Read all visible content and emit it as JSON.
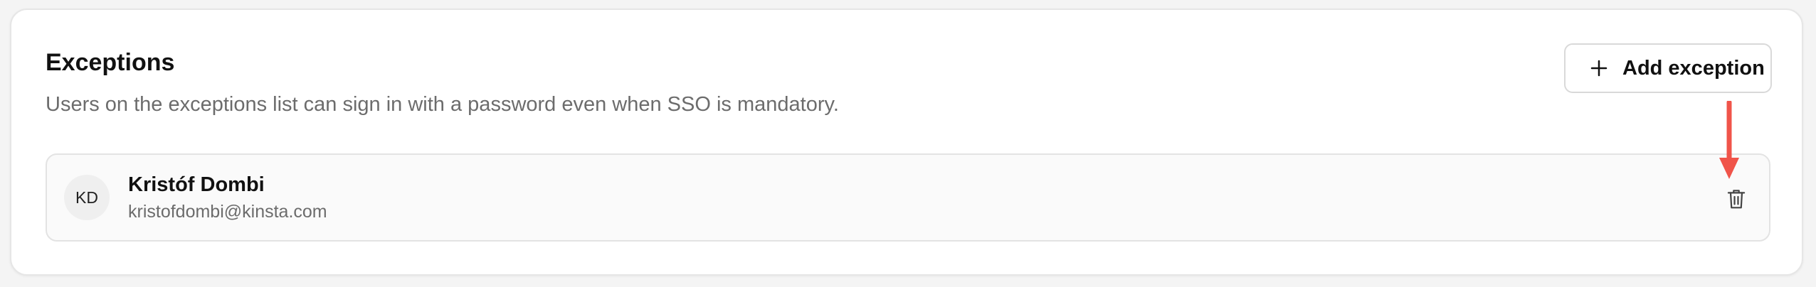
{
  "exceptions": {
    "title": "Exceptions",
    "description": "Users on the exceptions list can sign in with a password even when SSO is mandatory.",
    "add_button_label": "Add exception",
    "add_icon": "plus-icon",
    "users": [
      {
        "initials": "KD",
        "name": "Kristóf Dombi",
        "email": "kristofdombi@kinsta.com",
        "action_icon": "trash-icon"
      }
    ]
  },
  "annotation": {
    "icon": "arrow-down-icon",
    "color": "#f0544a"
  }
}
